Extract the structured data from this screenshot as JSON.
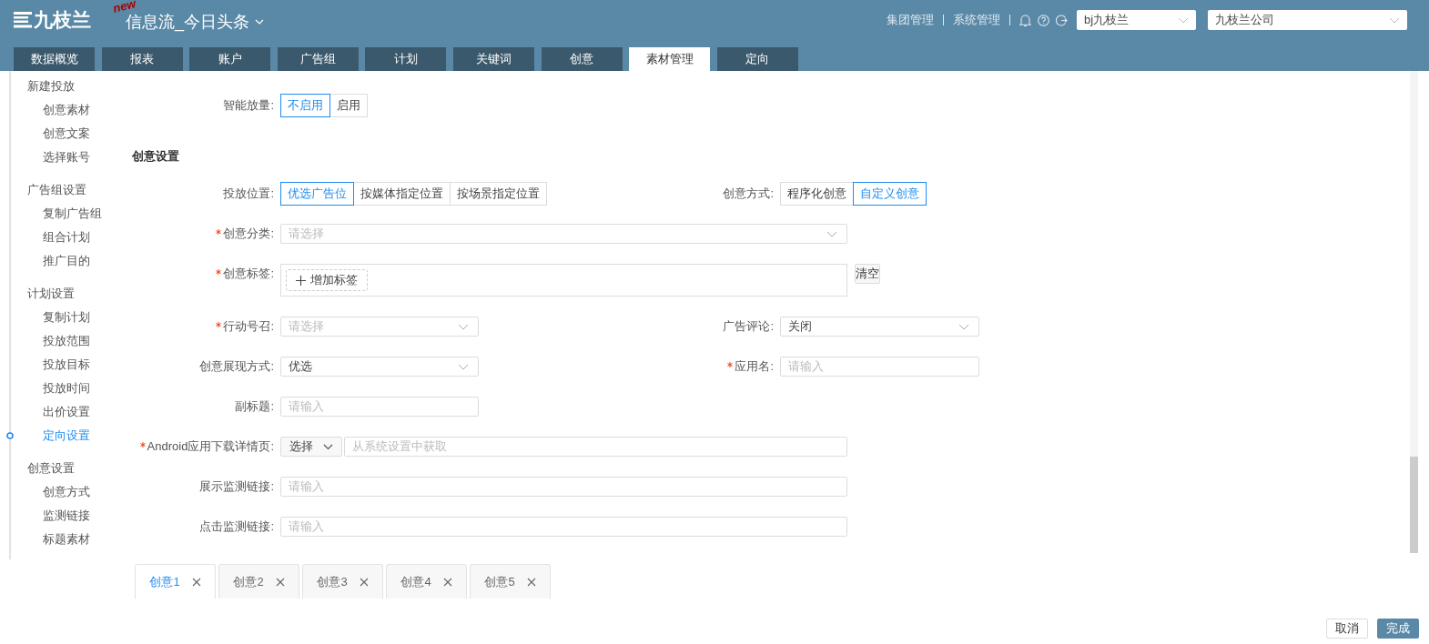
{
  "header": {
    "logo": "九枝兰",
    "badge": "new",
    "channel": "信息流_今日头条",
    "links": [
      "集团管理",
      "系统管理"
    ],
    "account_select": "bj九枝兰",
    "company_select": "九枝兰公司"
  },
  "nav_tabs": [
    {
      "label": "数据概览",
      "selected": false
    },
    {
      "label": "报表",
      "selected": false
    },
    {
      "label": "账户",
      "selected": false
    },
    {
      "label": "广告组",
      "selected": false
    },
    {
      "label": "计划",
      "selected": false
    },
    {
      "label": "关键词",
      "selected": false
    },
    {
      "label": "创意",
      "selected": false
    },
    {
      "label": "素材管理",
      "selected": true
    },
    {
      "label": "定向",
      "selected": false
    }
  ],
  "sidebar": [
    {
      "label": "新建投放",
      "children": [
        {
          "label": "创意素材",
          "selected": false
        },
        {
          "label": "创意文案",
          "selected": false
        },
        {
          "label": "选择账号",
          "selected": false
        }
      ]
    },
    {
      "label": "广告组设置",
      "children": [
        {
          "label": "复制广告组",
          "selected": false
        },
        {
          "label": "组合计划",
          "selected": false
        },
        {
          "label": "推广目的",
          "selected": false
        }
      ]
    },
    {
      "label": "计划设置",
      "children": [
        {
          "label": "复制计划",
          "selected": false
        },
        {
          "label": "投放范围",
          "selected": false
        },
        {
          "label": "投放目标",
          "selected": false
        },
        {
          "label": "投放时间",
          "selected": false
        },
        {
          "label": "出价设置",
          "selected": false
        },
        {
          "label": "定向设置",
          "selected": true
        }
      ]
    },
    {
      "label": "创意设置",
      "children": [
        {
          "label": "创意方式",
          "selected": false
        },
        {
          "label": "监测链接",
          "selected": false
        },
        {
          "label": "标题素材",
          "selected": false
        }
      ]
    }
  ],
  "form": {
    "pre_rows": [
      {
        "left": {
          "kind": "segmented",
          "label": "智能放量:",
          "required": false,
          "options": [
            {
              "label": "不启用",
              "selected": true
            },
            {
              "label": "启用",
              "selected": false
            }
          ]
        }
      }
    ],
    "section_title": "创意设置",
    "rows": [
      {
        "left": {
          "kind": "segmented",
          "label": "投放位置:",
          "required": false,
          "options": [
            {
              "label": "优选广告位",
              "selected": true
            },
            {
              "label": "按媒体指定位置",
              "selected": false
            },
            {
              "label": "按场景指定位置",
              "selected": false
            }
          ]
        },
        "right": {
          "kind": "segmented",
          "label": "创意方式:",
          "required": false,
          "options": [
            {
              "label": "程序化创意",
              "selected": false
            },
            {
              "label": "自定义创意",
              "selected": true
            }
          ]
        }
      },
      {
        "left": {
          "kind": "select",
          "label": "创意分类:",
          "required": true,
          "placeholder": "请选择"
        }
      },
      {
        "left": {
          "kind": "tags",
          "label": "创意标签:",
          "required": true,
          "add_label": "增加标签",
          "clear_label": "清空"
        }
      },
      {
        "left": {
          "kind": "select",
          "label": "行动号召:",
          "required": true,
          "placeholder": "请选择"
        },
        "right": {
          "kind": "select",
          "label": "广告评论:",
          "required": false,
          "value": "关闭"
        }
      },
      {
        "left": {
          "kind": "select",
          "label": "创意展现方式:",
          "required": false,
          "value": "优选"
        },
        "right": {
          "kind": "input",
          "label": "应用名:",
          "required": true,
          "placeholder": "请输入"
        }
      },
      {
        "left": {
          "kind": "input",
          "label": "副标题:",
          "required": false,
          "placeholder": "请输入"
        }
      },
      {
        "left": {
          "kind": "combo",
          "label": "Android应用下载详情页:",
          "required": true,
          "value": "选择",
          "placeholder": "从系统设置中获取"
        }
      },
      {
        "left": {
          "kind": "input",
          "label": "展示监测链接:",
          "required": false,
          "placeholder": "请输入"
        }
      },
      {
        "left": {
          "kind": "input",
          "label": "点击监测链接:",
          "required": false,
          "placeholder": "请输入"
        }
      }
    ]
  },
  "creative_tabs": [
    {
      "label": "创意1",
      "selected": true
    },
    {
      "label": "创意2",
      "selected": false
    },
    {
      "label": "创意3",
      "selected": false
    },
    {
      "label": "创意4",
      "selected": false
    },
    {
      "label": "创意5",
      "selected": false
    }
  ],
  "footer_buttons": [
    {
      "label": "取消",
      "kind": "secondary"
    },
    {
      "label": "完成",
      "kind": "primary"
    }
  ]
}
